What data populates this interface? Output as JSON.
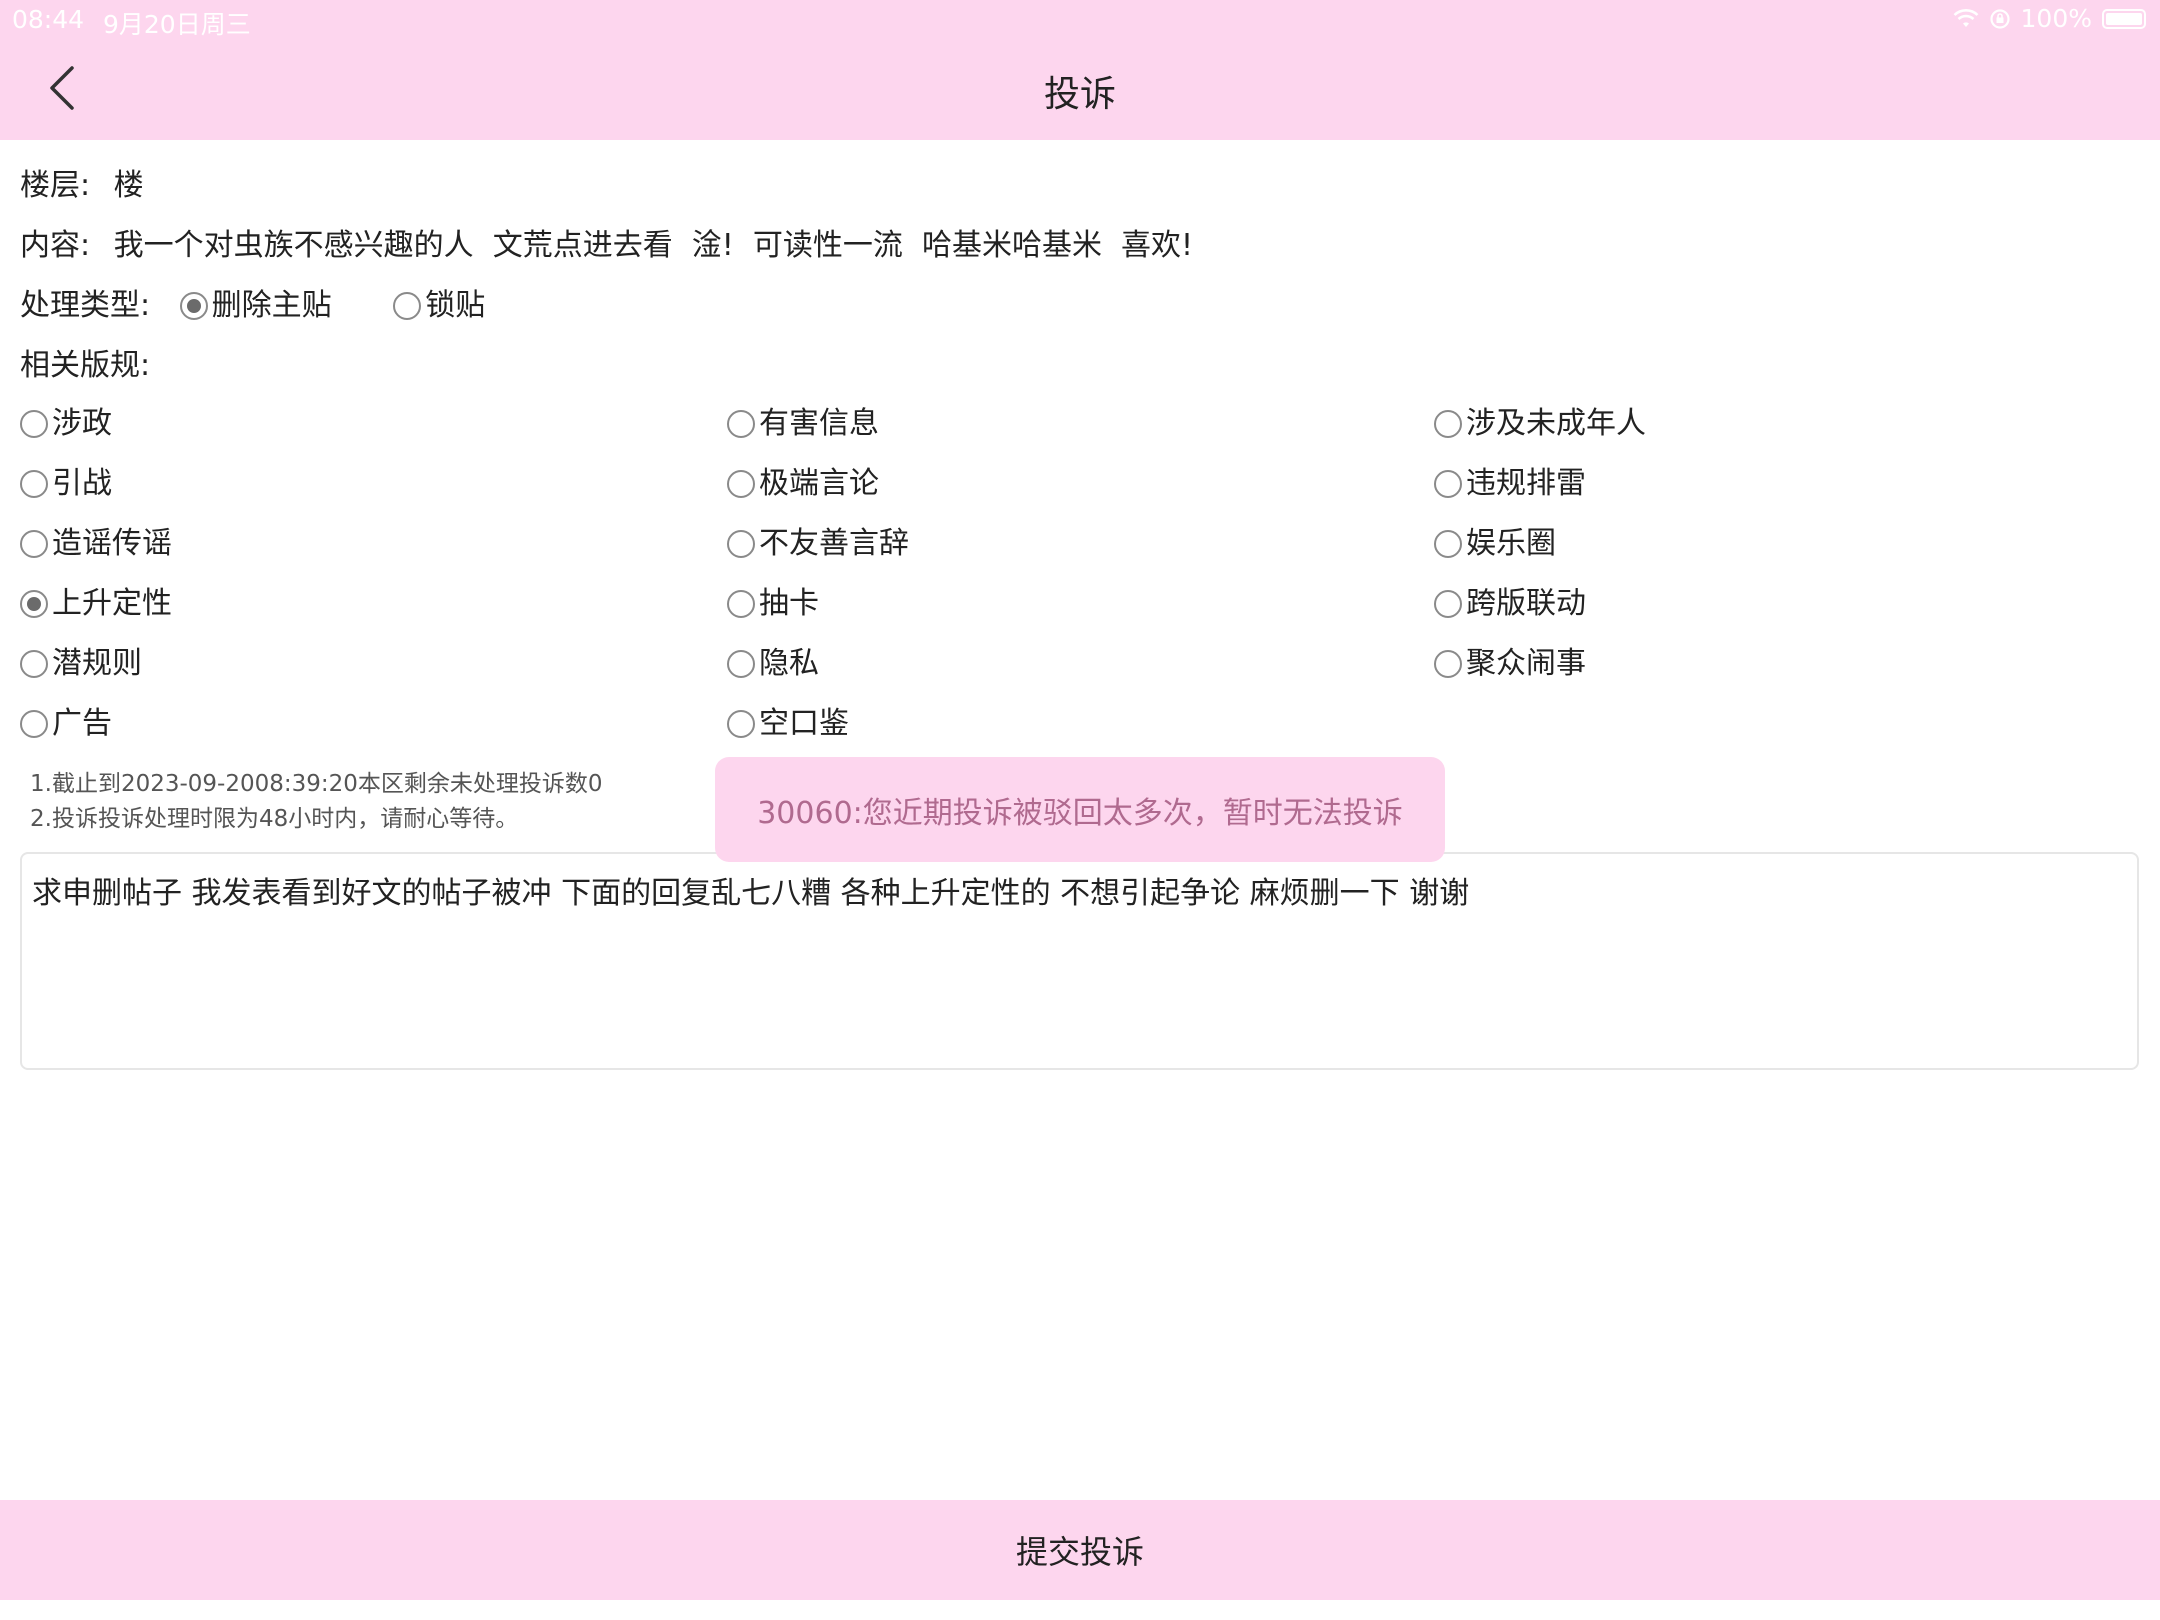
{
  "status_bar": {
    "time": "08:44",
    "date": "9月20日周三",
    "battery": "100%"
  },
  "header": {
    "title": "投诉",
    "back_icon": "chevron-left-icon"
  },
  "info": {
    "floor_label": "楼层:",
    "floor_value": "楼",
    "content_label": "内容:",
    "content_value": "我一个对虫族不感兴趣的人  文荒点进去看  淦!  可读性一流  哈基米哈基米  喜欢!"
  },
  "handle_type": {
    "label": "处理类型:",
    "options": [
      {
        "label": "删除主贴",
        "checked": true
      },
      {
        "label": "锁贴",
        "checked": false
      }
    ]
  },
  "rules": {
    "label": "相关版规:",
    "items": [
      {
        "label": "涉政",
        "checked": false
      },
      {
        "label": "有害信息",
        "checked": false
      },
      {
        "label": "涉及未成年人",
        "checked": false
      },
      {
        "label": "引战",
        "checked": false
      },
      {
        "label": "极端言论",
        "checked": false
      },
      {
        "label": "违规排雷",
        "checked": false
      },
      {
        "label": "造谣传谣",
        "checked": false
      },
      {
        "label": "不友善言辞",
        "checked": false
      },
      {
        "label": "娱乐圈",
        "checked": false
      },
      {
        "label": "上升定性",
        "checked": true
      },
      {
        "label": "抽卡",
        "checked": false
      },
      {
        "label": "跨版联动",
        "checked": false
      },
      {
        "label": "潜规则",
        "checked": false
      },
      {
        "label": "隐私",
        "checked": false
      },
      {
        "label": "聚众闹事",
        "checked": false
      },
      {
        "label": "广告",
        "checked": false
      },
      {
        "label": "空口鉴",
        "checked": false
      }
    ]
  },
  "notes": {
    "line1": "1.截止到2023-09-2008:39:20本区剩余未处理投诉数0",
    "line2": "2.投诉投诉处理时限为48小时内，请耐心等待。"
  },
  "toast": {
    "message": "30060:您近期投诉被驳回太多次，暂时无法投诉"
  },
  "reason": {
    "value": "求申删帖子 我发表看到好文的帖子被冲 下面的回复乱七八糟 各种上升定性的 不想引起争论 麻烦删一下 谢谢"
  },
  "submit": {
    "label": "提交投诉"
  },
  "colors": {
    "accent_pink": "#fdd6ee",
    "toast_text": "#b06a8f"
  }
}
